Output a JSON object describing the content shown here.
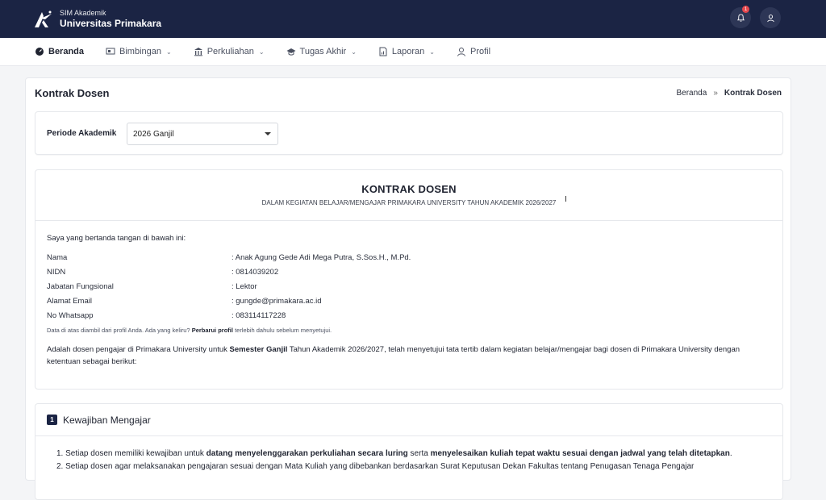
{
  "header": {
    "app_sub": "SIM Akademik",
    "app_name": "Universitas Primakara",
    "notif_count": "1"
  },
  "nav": {
    "items": [
      {
        "label": "Beranda",
        "icon": "dashboard-icon",
        "dropdown": false
      },
      {
        "label": "Bimbingan",
        "icon": "presentation-icon",
        "dropdown": true
      },
      {
        "label": "Perkuliahan",
        "icon": "institution-icon",
        "dropdown": true
      },
      {
        "label": "Tugas Akhir",
        "icon": "graduation-cap-icon",
        "dropdown": true
      },
      {
        "label": "Laporan",
        "icon": "report-icon",
        "dropdown": true
      },
      {
        "label": "Profil",
        "icon": "user-icon",
        "dropdown": false
      }
    ]
  },
  "page": {
    "title": "Kontrak Dosen",
    "breadcrumb": [
      "Beranda",
      "»",
      "Kontrak Dosen"
    ]
  },
  "periode": {
    "label": "Periode Akademik",
    "selected": "2026 Ganjil"
  },
  "kontrak": {
    "title": "KONTRAK DOSEN",
    "subtitle": "DALAM KEGIATAN BELAJAR/MENGAJAR PRIMAKARA UNIVERSITY TAHUN AKADEMIK 2026/2027",
    "intro": "Saya yang bertanda tangan di bawah ini:",
    "rows": [
      {
        "label": "Nama",
        "value": ": Anak Agung Gede Adi Mega Putra, S.Sos.H., M.Pd."
      },
      {
        "label": "NIDN",
        "value": ": 0814039202"
      },
      {
        "label": "Jabatan Fungsional",
        "value": ": Lektor"
      },
      {
        "label": "Alamat Email",
        "value": ": gungde@primakara.ac.id"
      },
      {
        "label": "No Whatsapp",
        "value": ": 083114117228"
      }
    ],
    "note_pre": "Data di atas diambil dari profil Anda. Ada yang keliru?",
    "note_link": "Perbarui profil",
    "note_post": "terlebih dahulu sebelum menyetujui.",
    "para_pre": "Adalah dosen pengajar di Primakara University untuk",
    "para_bold": "Semester Ganjil",
    "para_post": "Tahun Akademik 2026/2027, telah menyetujui tata tertib dalam kegiatan belajar/mengajar bagi dosen di Primakara University dengan ketentuan sebagai berikut:"
  },
  "kewajiban": {
    "number": "1",
    "title": "Kewajiban Mengajar",
    "item1_pre": "1. Setiap dosen memiliki kewajiban untuk",
    "item1_b1": "datang menyelenggarakan perkuliahan secara luring",
    "item1_mid": "serta",
    "item1_b2": "menyelesaikan kuliah tepat waktu sesuai dengan jadwal yang telah ditetapkan",
    "item1_end": ".",
    "item2": "2. Setiap dosen agar melaksanakan pengajaran sesuai dengan Mata Kuliah yang dibebankan berdasarkan Surat Keputusan Dekan Fakultas tentang Penugasan Tenaga Pengajar"
  }
}
